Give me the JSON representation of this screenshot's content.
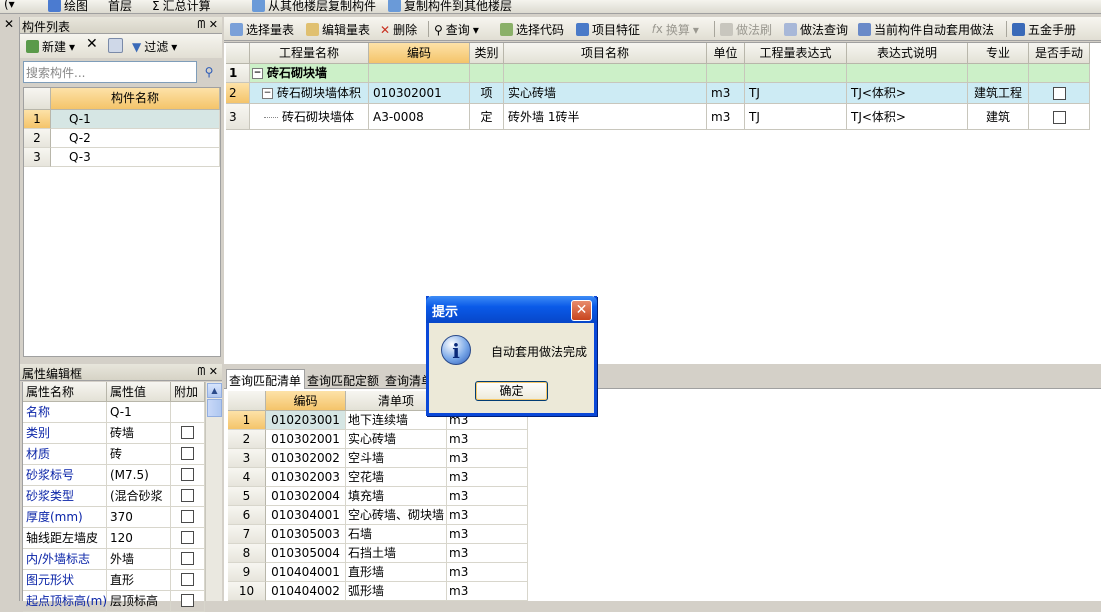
{
  "top_toolbar": {
    "draw": "绘图",
    "floor": "首层",
    "summary": "汇总计算",
    "copy_from": "从其他楼层复制构件",
    "copy_to": "复制构件到其他楼层"
  },
  "component_list": {
    "title": "构件列表",
    "new_label": "新建",
    "filter_label": "过滤",
    "search_placeholder": "搜索构件...",
    "column_header": "构件名称",
    "rows": [
      {
        "num": "1",
        "name": "Q-1"
      },
      {
        "num": "2",
        "name": "Q-2"
      },
      {
        "num": "3",
        "name": "Q-3"
      }
    ]
  },
  "properties": {
    "title": "属性编辑框",
    "headers": [
      "属性名称",
      "属性值",
      "附加"
    ],
    "rows": [
      {
        "name": "名称",
        "value": "Q-1"
      },
      {
        "name": "类别",
        "value": "砖墙"
      },
      {
        "name": "材质",
        "value": "砖"
      },
      {
        "name": "砂浆标号",
        "value": "(M7.5)"
      },
      {
        "name": "砂浆类型",
        "value": "(混合砂浆"
      },
      {
        "name": "厚度(mm)",
        "value": "370"
      },
      {
        "name": "轴线距左墙皮",
        "value": "120"
      },
      {
        "name": "内/外墙标志",
        "value": "外墙"
      },
      {
        "name": "图元形状",
        "value": "直形"
      },
      {
        "name": "起点顶标高(m)",
        "value": "层顶标高"
      }
    ]
  },
  "main_toolbar": {
    "select_qty": "选择量表",
    "edit_qty": "编辑量表",
    "delete": "删除",
    "query": "查询",
    "select_code": "选择代码",
    "project_feature": "项目特征",
    "calc": "换算",
    "method_brush": "做法刷",
    "method_query": "做法查询",
    "auto_apply": "当前构件自动套用做法",
    "manual": "五金手册"
  },
  "main_grid": {
    "headers": [
      "工程量名称",
      "编码",
      "类别",
      "项目名称",
      "单位",
      "工程量表达式",
      "表达式说明",
      "专业",
      "是否手动"
    ],
    "rows": [
      {
        "num": "1",
        "name": "砖石砌块墙",
        "code": "",
        "type": "",
        "item": "",
        "unit": "",
        "expr": "",
        "desc": "",
        "major": ""
      },
      {
        "num": "2",
        "name": "砖石砌块墙体积",
        "code": "010302001",
        "type": "项",
        "item": "实心砖墙",
        "unit": "m3",
        "expr": "TJ",
        "desc": "TJ<体积>",
        "major": "建筑工程"
      },
      {
        "num": "3",
        "name": "砖石砌块墙体",
        "code": "A3-0008",
        "type": "定",
        "item": "砖外墙 1砖半",
        "unit": "m3",
        "expr": "TJ",
        "desc": "TJ<体积>",
        "major": "建筑"
      }
    ]
  },
  "bottom_tabs": [
    "查询匹配清单",
    "查询匹配定额",
    "查询清单库"
  ],
  "bottom_grid": {
    "headers": [
      "编码",
      "清单项",
      "单位"
    ],
    "rows": [
      {
        "num": "1",
        "code": "010203001",
        "item": "地下连续墙",
        "unit": "m3"
      },
      {
        "num": "2",
        "code": "010302001",
        "item": "实心砖墙",
        "unit": "m3"
      },
      {
        "num": "3",
        "code": "010302002",
        "item": "空斗墙",
        "unit": "m3"
      },
      {
        "num": "4",
        "code": "010302003",
        "item": "空花墙",
        "unit": "m3"
      },
      {
        "num": "5",
        "code": "010302004",
        "item": "填充墙",
        "unit": "m3"
      },
      {
        "num": "6",
        "code": "010304001",
        "item": "空心砖墙、砌块墙",
        "unit": "m3"
      },
      {
        "num": "7",
        "code": "010305003",
        "item": "石墙",
        "unit": "m3"
      },
      {
        "num": "8",
        "code": "010305004",
        "item": "石挡土墙",
        "unit": "m3"
      },
      {
        "num": "9",
        "code": "010404001",
        "item": "直形墙",
        "unit": "m3"
      },
      {
        "num": "10",
        "code": "010404002",
        "item": "弧形墙",
        "unit": "m3"
      }
    ]
  },
  "dialog": {
    "title": "提示",
    "message": "自动套用做法完成",
    "ok": "确定"
  }
}
